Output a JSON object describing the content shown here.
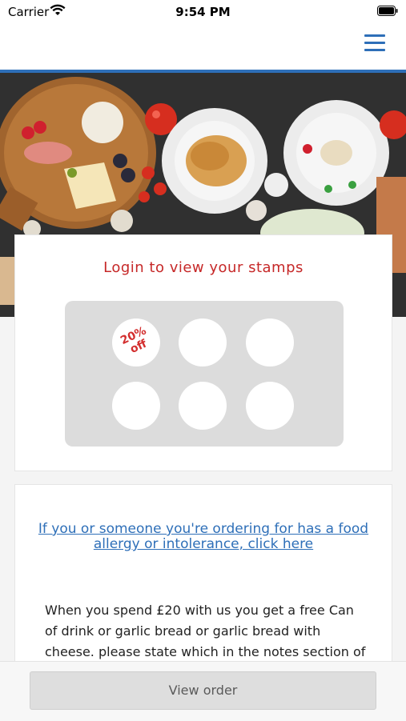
{
  "status_bar": {
    "carrier": "Carrier",
    "time": "9:54 PM"
  },
  "nav": {
    "menu_icon": "hamburger-menu-icon",
    "accent_color": "#2e6fb8"
  },
  "hero": {
    "image": "food-platter-photo"
  },
  "stamps": {
    "title": "Login to view your stamps",
    "title_color": "#c62828",
    "reward_line1": "20%",
    "reward_line2": "off",
    "total_slots": 6
  },
  "info": {
    "allergy_link": "If you or someone you're ordering for has a food allergy or intolerance, click here",
    "offer_text": "When you spend £20 with us you get a free Can of drink or garlic bread or garlic bread with cheese. please state which in the notes section of"
  },
  "footer": {
    "view_order_label": "View order"
  }
}
